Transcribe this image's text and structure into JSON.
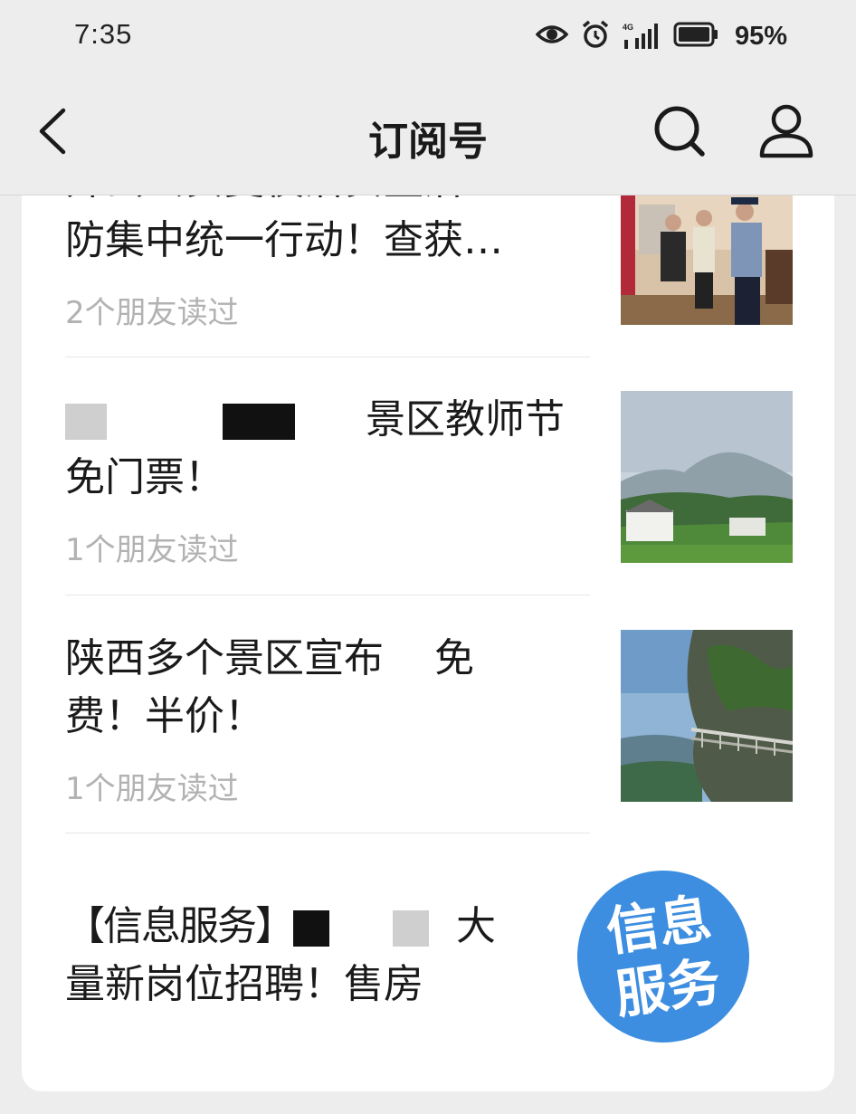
{
  "status_bar": {
    "time": "7:35",
    "network_label": "4G",
    "battery": "95%"
  },
  "nav": {
    "title": "订阅号"
  },
  "articles": [
    {
      "title": "开县公安夏夜治安整治集中行动防集中统一行动！查获…",
      "title_visible_line": "防集中统一行动！查获…",
      "meta": "2个朋友读过",
      "thumbnail": "police-scene-photo"
    },
    {
      "title_parts": [
        "景区教师节",
        "免门票！"
      ],
      "meta": "1个朋友读过",
      "thumbnail": "misty-mountain-landscape-photo"
    },
    {
      "title_parts": [
        "陕西多个景区宣布",
        "免",
        "费！半价！"
      ],
      "meta": "1个朋友读过",
      "thumbnail": "cliff-walkway-photo"
    },
    {
      "title_parts": [
        "【信息服务】",
        "大",
        "量新岗位招聘！售房"
      ],
      "thumbnail": "info-service-badge",
      "badge_line1": "信息",
      "badge_line2": "服务"
    }
  ],
  "colors": {
    "background": "#ededed",
    "card": "#ffffff",
    "meta_text": "#b2b2b2",
    "badge_blue": "#3d8ee0"
  }
}
